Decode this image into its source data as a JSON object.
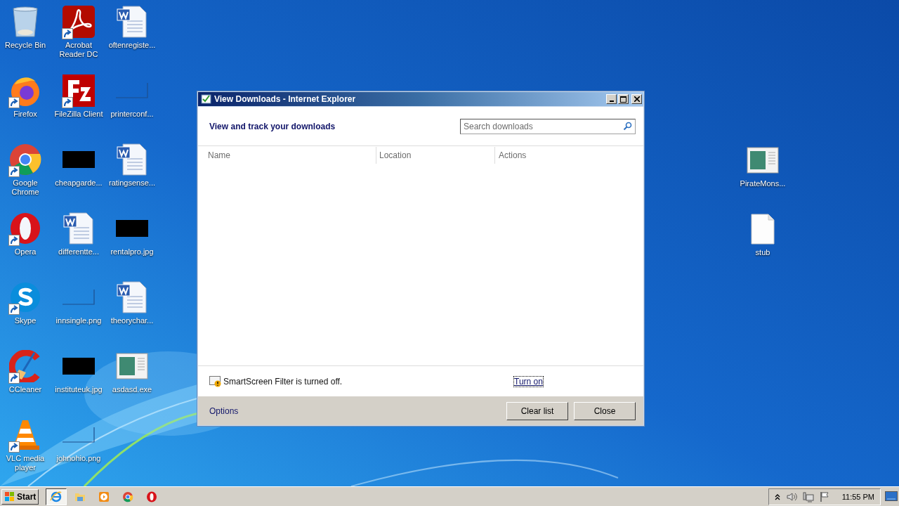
{
  "desktop": {
    "columns": [
      {
        "icons": [
          {
            "label": "Recycle Bin",
            "kind": "recycle",
            "shortcut": false
          },
          {
            "label": "Firefox",
            "kind": "firefox",
            "shortcut": true
          },
          {
            "label": "Google Chrome",
            "kind": "chrome",
            "shortcut": true
          },
          {
            "label": "Opera",
            "kind": "opera",
            "shortcut": true
          },
          {
            "label": "Skype",
            "kind": "skype",
            "shortcut": true
          },
          {
            "label": "CCleaner",
            "kind": "ccleaner",
            "shortcut": true
          },
          {
            "label": "VLC media player",
            "kind": "vlc",
            "shortcut": true
          }
        ]
      },
      {
        "icons": [
          {
            "label": "Acrobat Reader DC",
            "kind": "acrobat",
            "shortcut": true
          },
          {
            "label": "FileZilla Client",
            "kind": "filezilla",
            "shortcut": true
          },
          {
            "label": "cheapgarde...",
            "kind": "dark-image",
            "shortcut": false
          },
          {
            "label": "differentte...",
            "kind": "word",
            "shortcut": false
          },
          {
            "label": "innsingle.png",
            "kind": "blank-image",
            "shortcut": false
          },
          {
            "label": "instituteuk.jpg",
            "kind": "dark-image",
            "shortcut": false
          },
          {
            "label": "johnohio.png",
            "kind": "blank-image",
            "shortcut": false
          }
        ]
      },
      {
        "icons": [
          {
            "label": "oftenregiste...",
            "kind": "word",
            "shortcut": false
          },
          {
            "label": "printerconf...",
            "kind": "blank-image",
            "shortcut": false
          },
          {
            "label": "ratingsense...",
            "kind": "word",
            "shortcut": false
          },
          {
            "label": "rentalpro.jpg",
            "kind": "dark-image",
            "shortcut": false
          },
          {
            "label": "theorychar...",
            "kind": "word",
            "shortcut": false
          },
          {
            "label": "asdasd.exe",
            "kind": "exe",
            "shortcut": false
          }
        ]
      }
    ],
    "right_icons": [
      {
        "label": "PirateMons...",
        "kind": "exe",
        "shortcut": false
      },
      {
        "label": "stub",
        "kind": "file",
        "shortcut": false
      }
    ]
  },
  "window": {
    "title": "View Downloads - Internet Explorer",
    "heading": "View and track your downloads",
    "search": {
      "placeholder": "Search downloads"
    },
    "columns": [
      "Name",
      "Location",
      "Actions"
    ],
    "smartscreen": {
      "message": "SmartScreen Filter is turned off.",
      "link": "Turn on"
    },
    "options": "Options",
    "buttons": [
      "Clear list",
      "Close"
    ]
  },
  "taskbar": {
    "start": "Start",
    "items": [
      {
        "kind": "ie",
        "selected": true
      },
      {
        "kind": "folder",
        "selected": false
      },
      {
        "kind": "media",
        "selected": false
      },
      {
        "kind": "chrome",
        "selected": false
      },
      {
        "kind": "opera",
        "selected": false
      }
    ],
    "clock": "11:55 PM"
  }
}
